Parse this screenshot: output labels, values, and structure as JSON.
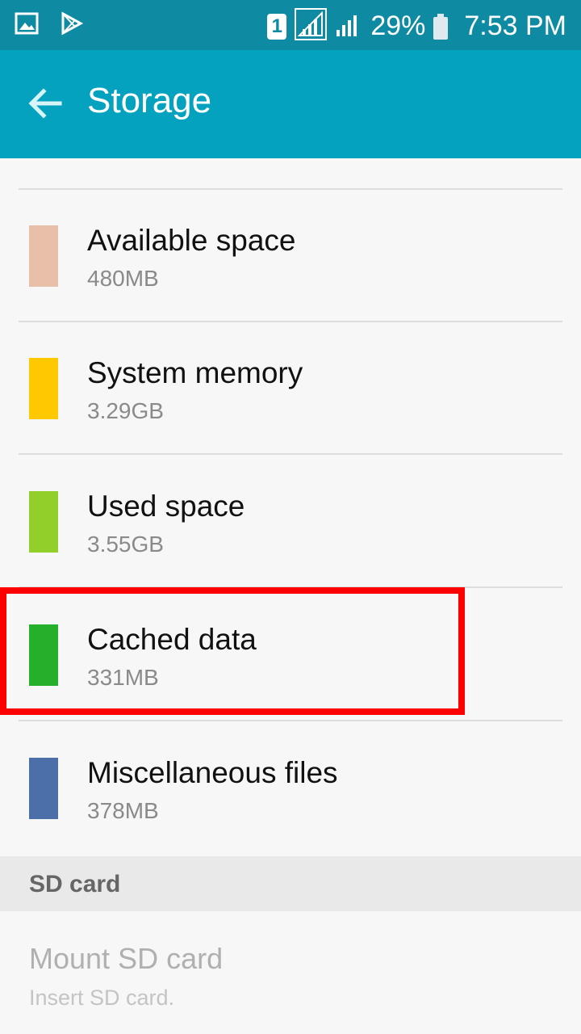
{
  "status_bar": {
    "sim_label": "1",
    "battery": "29%",
    "time": "7:53 PM"
  },
  "header": {
    "title": "Storage",
    "back_icon": "arrow-left-icon"
  },
  "storage_items": [
    {
      "label": "Available space",
      "value": "480MB",
      "color": "#e8bfa8"
    },
    {
      "label": "System memory",
      "value": "3.29GB",
      "color": "#ffc800"
    },
    {
      "label": "Used space",
      "value": "3.55GB",
      "color": "#93cf2b"
    },
    {
      "label": "Cached data",
      "value": "331MB",
      "color": "#24b02b",
      "highlighted": true
    },
    {
      "label": "Miscellaneous files",
      "value": "378MB",
      "color": "#4c6ea9"
    }
  ],
  "sd_section": {
    "header": "SD card",
    "mount_label": "Mount SD card",
    "mount_value": "Insert SD card."
  },
  "colors": {
    "status_bar": "#0e8aa3",
    "app_bar": "#05a2bf",
    "highlight": "#ff0000"
  }
}
